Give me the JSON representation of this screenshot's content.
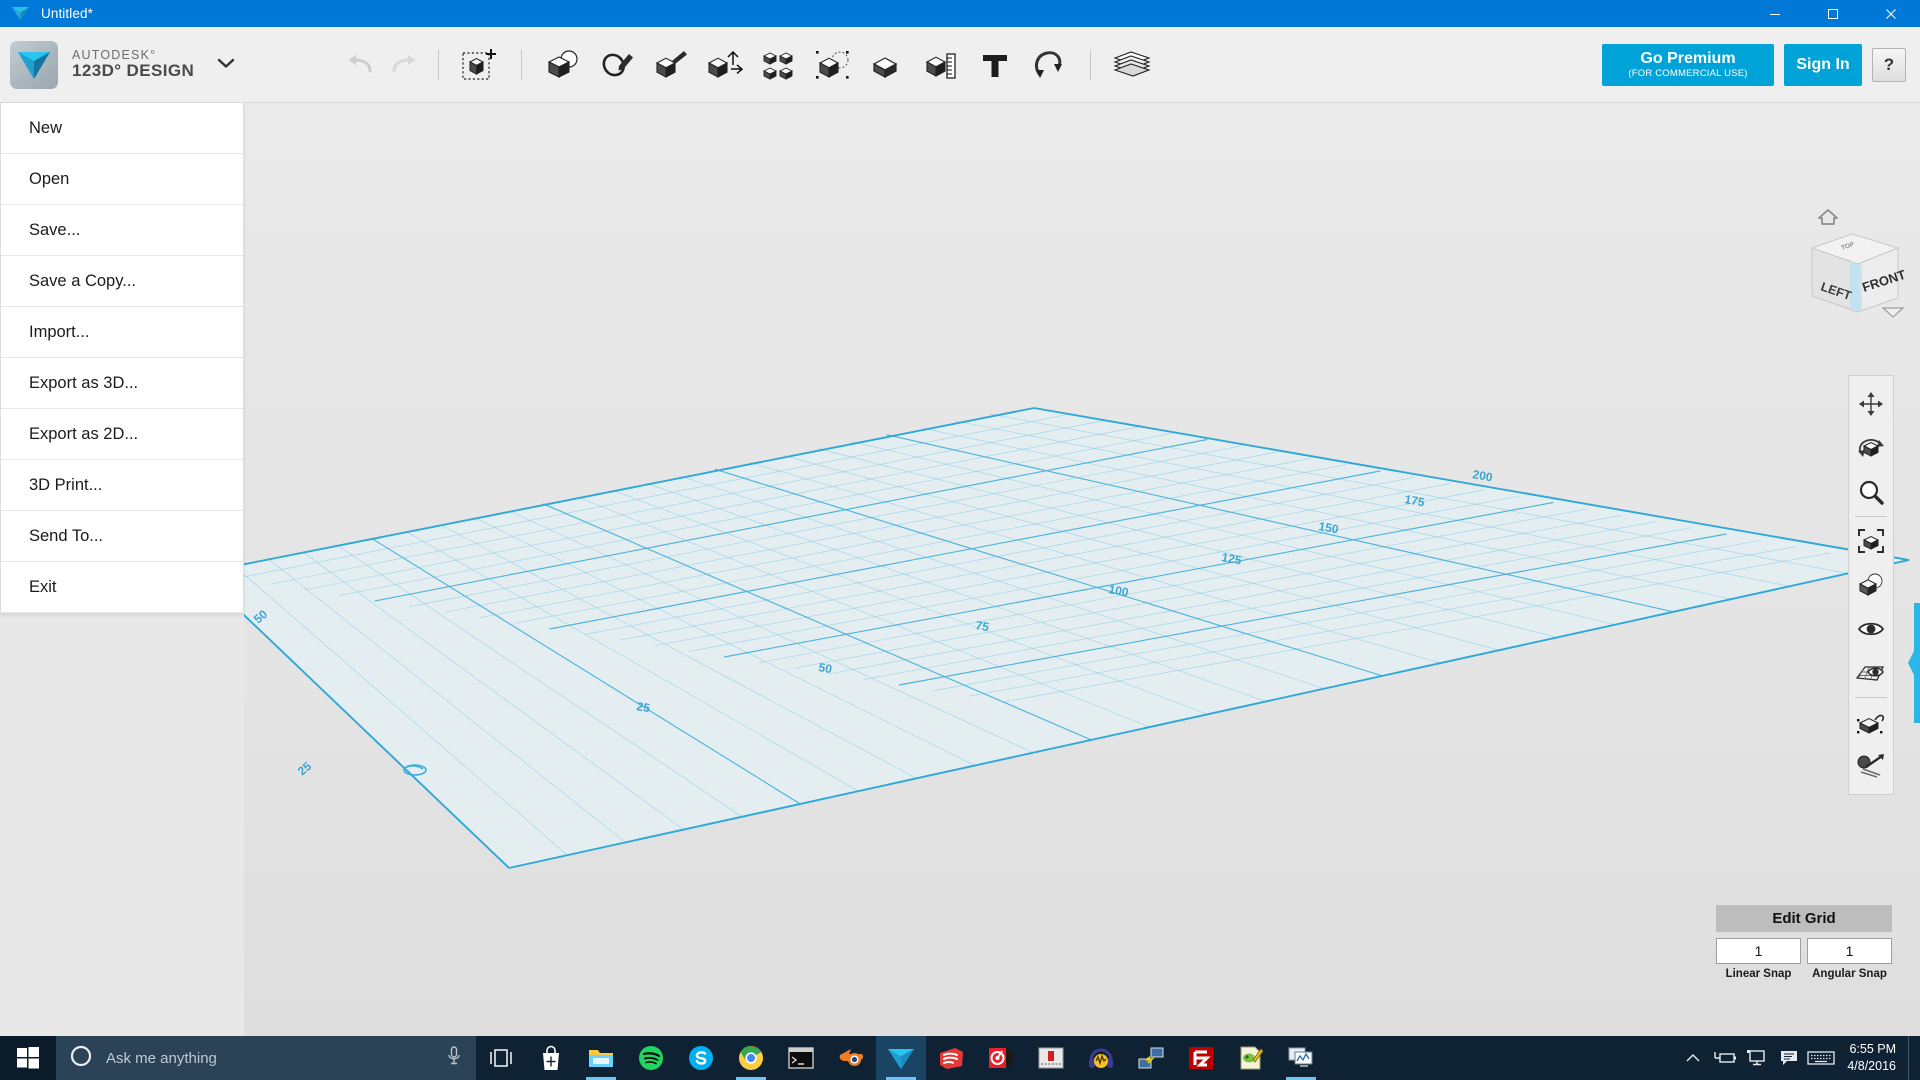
{
  "window": {
    "title": "Untitled*",
    "logo_icon": "123d-design-logo-icon",
    "minimize_label": "─",
    "maximize_label": "❐",
    "close_label": "✕"
  },
  "brand": {
    "line1": "AUTODESK°",
    "line2": "123D° DESIGN",
    "tile_icon": "123d-design-app-icon",
    "caret_icon": "chevron-down-icon"
  },
  "toolbar": {
    "undo": {
      "label": "Undo",
      "icon": "undo-arrow-icon"
    },
    "redo": {
      "label": "Redo",
      "icon": "redo-arrow-icon"
    },
    "transform": {
      "label": "Transform",
      "icon": "transform-cube-icon"
    },
    "items": [
      {
        "label": "Primitives",
        "icon": "primitives-icon"
      },
      {
        "label": "Sketch",
        "icon": "sketch-pen-icon"
      },
      {
        "label": "Construct",
        "icon": "construct-extrude-icon"
      },
      {
        "label": "Modify",
        "icon": "modify-axis-icon"
      },
      {
        "label": "Pattern",
        "icon": "pattern-grid-icon"
      },
      {
        "label": "Grouping",
        "icon": "grouping-icon"
      },
      {
        "label": "Combine",
        "icon": "combine-icon"
      },
      {
        "label": "Measure",
        "icon": "measure-ruler-icon"
      },
      {
        "label": "Text",
        "icon": "text-t-icon"
      },
      {
        "label": "Snap",
        "icon": "snap-magnet-icon"
      }
    ],
    "materials": {
      "label": "Materials",
      "icon": "materials-stack-icon"
    }
  },
  "account": {
    "premium_title": "Go Premium",
    "premium_subtitle": "(FOR COMMERCIAL USE)",
    "signin_label": "Sign In",
    "help_label": "?",
    "accent_color": "#00a3d8"
  },
  "file_menu": {
    "items": [
      {
        "label": "New"
      },
      {
        "label": "Open"
      },
      {
        "label": "Save..."
      },
      {
        "label": "Save a Copy..."
      },
      {
        "label": "Import..."
      },
      {
        "label": "Export as 3D..."
      },
      {
        "label": "Export as 2D..."
      },
      {
        "label": "3D Print..."
      },
      {
        "label": "Send To..."
      },
      {
        "label": "Exit"
      }
    ]
  },
  "viewport": {
    "grid_color": "#3eaddc",
    "grid_fill": "#e4eef1",
    "background_color": "#e6e6e6",
    "axis_labels_left": [
      "100",
      "75",
      "50",
      "25"
    ],
    "axis_labels_right": [
      "150",
      "125",
      "100",
      "75",
      "50",
      "25"
    ]
  },
  "viewcube": {
    "face_front": "FRONT",
    "face_left": "LEFT",
    "face_top": "TOP",
    "home_icon": "home-icon",
    "menu_icon": "viewcube-menu-arrow-icon"
  },
  "navbar": {
    "items": [
      {
        "label": "Pan",
        "icon": "pan-arrows-icon"
      },
      {
        "label": "Orbit",
        "icon": "orbit-icon"
      },
      {
        "label": "Zoom",
        "icon": "zoom-magnifier-icon"
      },
      {
        "label": "Fit",
        "icon": "fit-to-view-icon"
      },
      {
        "label": "Shading",
        "icon": "shading-cube-icon"
      },
      {
        "label": "Visibility",
        "icon": "eye-visibility-icon"
      },
      {
        "label": "Grid Snap",
        "icon": "grid-snap-icon"
      },
      {
        "label": "Select Visible",
        "icon": "select-visible-icon"
      },
      {
        "label": "Smart Scale",
        "icon": "smart-scale-icon"
      }
    ]
  },
  "grid_panel": {
    "title": "Edit Grid",
    "linear_snap_value": "1",
    "linear_snap_label": "Linear Snap",
    "angular_snap_value": "1",
    "angular_snap_label": "Angular Snap"
  },
  "taskbar": {
    "start_icon": "windows-start-icon",
    "cortana": {
      "icon": "cortana-circle-icon",
      "placeholder": "Ask me anything",
      "mic_icon": "microphone-icon"
    },
    "apps": [
      {
        "name": "Task View",
        "icon": "task-view-icon",
        "active": false,
        "running": false
      },
      {
        "name": "Microsoft Store",
        "icon": "store-bag-icon",
        "active": false,
        "running": false
      },
      {
        "name": "File Explorer",
        "icon": "file-explorer-icon",
        "active": false,
        "running": true
      },
      {
        "name": "Spotify",
        "icon": "spotify-icon",
        "active": false,
        "running": false
      },
      {
        "name": "Skype",
        "icon": "skype-icon",
        "active": false,
        "running": false
      },
      {
        "name": "Google Chrome",
        "icon": "chrome-icon",
        "active": false,
        "running": true
      },
      {
        "name": "Command Prompt",
        "icon": "terminal-icon",
        "active": false,
        "running": false
      },
      {
        "name": "Blender",
        "icon": "blender-icon",
        "active": false,
        "running": false
      },
      {
        "name": "123D Design",
        "icon": "123d-design-taskbar-icon",
        "active": true,
        "running": true
      },
      {
        "name": "SketchUp",
        "icon": "sketchup-icon",
        "active": false,
        "running": false
      },
      {
        "name": "Autodesk App",
        "icon": "autodesk-red-icon",
        "active": false,
        "running": false
      },
      {
        "name": "Slicer",
        "icon": "slicer-icon",
        "active": false,
        "running": false
      },
      {
        "name": "Audacity",
        "icon": "audacity-headphones-icon",
        "active": false,
        "running": false
      },
      {
        "name": "Remote Desktop",
        "icon": "network-connection-icon",
        "active": false,
        "running": false
      },
      {
        "name": "FileZilla",
        "icon": "filezilla-icon",
        "active": false,
        "running": false
      },
      {
        "name": "Notepad Editor",
        "icon": "notepad-editor-icon",
        "active": false,
        "running": false
      },
      {
        "name": "System Monitor",
        "icon": "system-monitor-icon",
        "active": false,
        "running": true
      }
    ],
    "tray": [
      {
        "name": "Show hidden icons",
        "icon": "chevron-up-icon"
      },
      {
        "name": "Power",
        "icon": "battery-power-icon"
      },
      {
        "name": "Network",
        "icon": "network-monitor-icon"
      },
      {
        "name": "Action Center",
        "icon": "speech-bubble-icon"
      },
      {
        "name": "Touch Keyboard",
        "icon": "keyboard-icon"
      }
    ],
    "clock": {
      "time": "6:55 PM",
      "date": "4/8/2016"
    }
  }
}
